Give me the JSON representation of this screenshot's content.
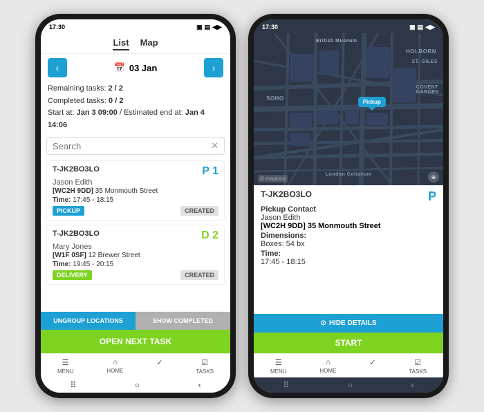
{
  "phone_left": {
    "status_bar": {
      "time": "17:30",
      "icons": "▣ ▤ ▲ ▶ ◀"
    },
    "tabs": {
      "list": "List",
      "map": "Map",
      "active": "list"
    },
    "date_nav": {
      "prev_label": "‹",
      "next_label": "›",
      "date": "03 Jan",
      "calendar_icon": "📅"
    },
    "task_info": {
      "remaining": "2 / 2",
      "completed": "0 / 2",
      "start_at": "Jan 3 09:00",
      "estimated_end": "Jan 4 14:06",
      "full_text": "Remaining tasks: 2 / 2\nCompleted tasks: 0 / 2\nStart at: Jan 3 09:00 / Estimated end at: Jan 4 14:06"
    },
    "search": {
      "placeholder": "Search",
      "close": "✕"
    },
    "tasks": [
      {
        "id": "T-JK2BO3LO",
        "name": "Jason Edith",
        "postcode": "[WC2H 9DD]",
        "address": "35 Monmouth Street",
        "time_label": "Time:",
        "time": "17:45 - 18:15",
        "type": "PICKUP",
        "status": "CREATED",
        "priority": "P 1",
        "priority_type": "P"
      },
      {
        "id": "T-JK2BO3LO",
        "name": "Mary Jones",
        "postcode": "[W1F 0SF]",
        "address": "12 Brewer Street",
        "time_label": "Time:",
        "time": "19:45 - 20:15",
        "type": "DELIVERY",
        "status": "CREATED",
        "priority": "D 2",
        "priority_type": "D"
      }
    ],
    "bottom_buttons": {
      "ungroup": "UNGROUP LOCATIONS",
      "show_completed": "SHOW COMPLETED",
      "open_next": "OPEN NEXT TASK"
    },
    "nav": [
      {
        "icon": "☰",
        "label": "MENU"
      },
      {
        "icon": "⌂",
        "label": "HOME"
      },
      {
        "icon": "✓",
        "label": ""
      },
      {
        "icon": "☑",
        "label": "TASKS"
      }
    ],
    "android_nav": [
      "⠿",
      "○",
      "‹"
    ]
  },
  "phone_right": {
    "status_bar": {
      "time": "17:30",
      "icons": "▣ ▤ ▲ ▶ ◀"
    },
    "map": {
      "pickup_label": "Pickup",
      "mapbox_label": "© mapbox",
      "place_labels": [
        "British Museum",
        "HOLBORN",
        "ST. GILES",
        "SOHO",
        "COVENT GARDEN",
        "London Coliseum"
      ]
    },
    "detail": {
      "id": "T-JK2BO3LO",
      "priority": "P",
      "contact_label": "Pickup Contact",
      "contact_name": "Jason Edith",
      "postcode": "[WC2H 9DD]",
      "address": "35 Monmouth Street",
      "dimensions_label": "Dimensions:",
      "dimensions_value": "Boxes: 54 bx",
      "time_label": "Time:",
      "time_value": "17:45 - 18:15"
    },
    "buttons": {
      "hide_details": "HIDE DETAILS",
      "start": "START"
    },
    "nav": [
      {
        "icon": "☰",
        "label": "MENU"
      },
      {
        "icon": "⌂",
        "label": "HOME"
      },
      {
        "icon": "✓",
        "label": ""
      },
      {
        "icon": "☑",
        "label": "TASKS"
      }
    ],
    "android_nav": [
      "⠿",
      "○",
      "‹"
    ]
  }
}
